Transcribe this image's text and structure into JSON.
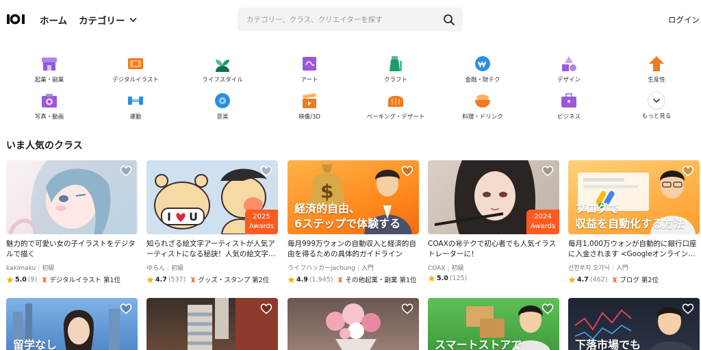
{
  "header": {
    "home": "ホーム",
    "category": "カテゴリー",
    "search_placeholder": "カテゴリー、クラス、クリエイターを探す",
    "login": "ログイン"
  },
  "categories": [
    {
      "label": "起業・副業",
      "icon": "shop-icon",
      "color": "#8e5bd6"
    },
    {
      "label": "デジタルイラスト",
      "icon": "tablet-icon",
      "color": "#f07a1c"
    },
    {
      "label": "ライフスタイル",
      "icon": "sprout-icon",
      "color": "#1e9c67"
    },
    {
      "label": "アート",
      "icon": "canvas-icon",
      "color": "#9b59d8"
    },
    {
      "label": "クラフト",
      "icon": "paint-jar-icon",
      "color": "#1e9c67"
    },
    {
      "label": "金融・財テク",
      "icon": "coin-icon",
      "color": "#2b8fe0"
    },
    {
      "label": "デザイン",
      "icon": "shapes-icon",
      "color": "#9b59d8"
    },
    {
      "label": "生産性",
      "icon": "arrow-up-icon",
      "color": "#f07a1c"
    },
    {
      "label": "写真・動画",
      "icon": "camera-icon",
      "color": "#9b59d8"
    },
    {
      "label": "運動",
      "icon": "dumbbell-icon",
      "color": "#2b8fe0"
    },
    {
      "label": "音楽",
      "icon": "disc-icon",
      "color": "#2b8fe0"
    },
    {
      "label": "映像/3D",
      "icon": "clapperboard-icon",
      "color": "#f07a1c"
    },
    {
      "label": "ベーキング・デザート",
      "icon": "bread-icon",
      "color": "#f07a1c"
    },
    {
      "label": "料理・ドリンク",
      "icon": "bowl-icon",
      "color": "#f07a1c"
    },
    {
      "label": "ビジネス",
      "icon": "briefcase-icon",
      "color": "#9b59d8"
    },
    {
      "label": "もっと見る",
      "icon": "chevron-down-icon",
      "color": "#333333"
    }
  ],
  "section_title": "いま人気のクラス",
  "cards": [
    {
      "title": "魅力的で可愛い女の子イラストをデジタルで描く",
      "creator": "kakimaku",
      "level": "初級",
      "rating": "4.9",
      "rating_display": "5.0",
      "count": "(9)",
      "rank": "デジタルイラスト 第1位",
      "badge": null,
      "overlay": null
    },
    {
      "title": "知られざる絵文字アーティストが人気アーティストになる秘訣！人気の絵文字…",
      "creator": "ゆらん",
      "level": "初級",
      "rating_display": "4.7",
      "count": "(537)",
      "rank": "グッズ・スタンプ 第2位",
      "badge": [
        "2025",
        "Awards"
      ],
      "overlay": null
    },
    {
      "title": "毎月999万ウォンの自動収入と経済的自由を得るための具体的ガイドライン",
      "creator": "ライフハッカーjachung",
      "level": "入門",
      "rating_display": "4.9",
      "count": "(1,945)",
      "rank": "その他起業・副業 第1位",
      "badge": null,
      "overlay": [
        "経済的自由、",
        "6ステップで体験する"
      ]
    },
    {
      "title": "COAXの㊙テクで初心者でも人気イラストレーターに！",
      "creator": "COAX",
      "level": "初級",
      "rating_display": "5.0",
      "count": "(125)",
      "rank": "",
      "badge": [
        "2024",
        "Awards"
      ],
      "overlay": null
    },
    {
      "title": "毎月1,000万ウォンが自動的に銀行口座に入金されます <Googleオンライン…",
      "creator": "선한부자 오가닉",
      "level": "入門",
      "rating_display": "4.7",
      "count": "(462)",
      "rank": "ブログ 第2位",
      "badge": null,
      "overlay": [
        "ブログで",
        "収益を自動化する方法"
      ]
    }
  ],
  "cards_row2": [
    {
      "overlay": "留学なし"
    },
    {
      "overlay": ""
    },
    {
      "overlay": ""
    },
    {
      "overlay": "スマートストアで"
    },
    {
      "overlay": "下落市場でも"
    }
  ],
  "colors": {
    "accent": "#ff5a1f",
    "star": "#f5b400",
    "rank_icon": "#ff5a1f"
  }
}
